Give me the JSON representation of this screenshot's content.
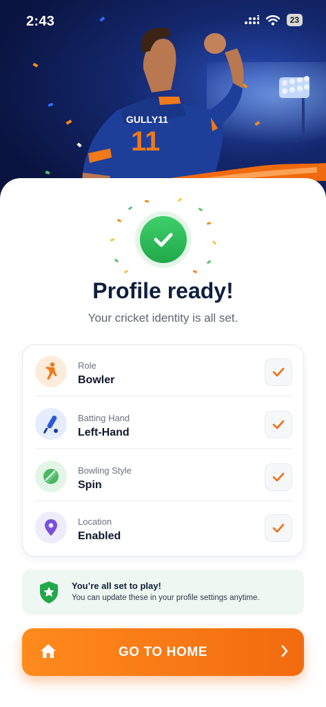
{
  "status_bar": {
    "time": "2:43",
    "battery": "23"
  },
  "hero": {
    "jersey_name": "GULLY11",
    "jersey_number": "11"
  },
  "header": {
    "title": "Profile ready!",
    "subtitle": "Your cricket identity is all set."
  },
  "profile_items": [
    {
      "label": "Role",
      "value": "Bowler",
      "icon": "bowler-icon"
    },
    {
      "label": "Batting Hand",
      "value": "Left-Hand",
      "icon": "cricket-bat-icon"
    },
    {
      "label": "Bowling Style",
      "value": "Spin",
      "icon": "cricket-ball-icon"
    },
    {
      "label": "Location",
      "value": "Enabled",
      "icon": "location-pin-icon"
    }
  ],
  "notice": {
    "title": "You’re all set to play!",
    "text": "You can update these in your profile settings anytime."
  },
  "cta": {
    "label": "GO TO HOME"
  },
  "colors": {
    "accent": "#f26b0f",
    "success": "#21a84a",
    "heading": "#0f1f3d"
  }
}
